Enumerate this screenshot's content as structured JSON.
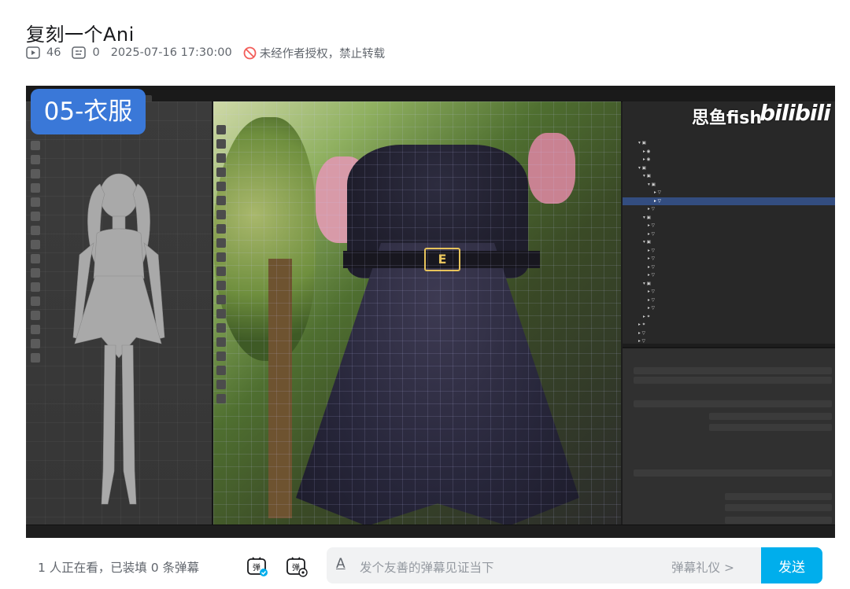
{
  "video": {
    "title": "复刻一个Ani",
    "play_count": "46",
    "danmaku_count": "0",
    "publish_time": "2025-07-16 17:30:00",
    "copyright_notice": "未经作者授权，禁止转载"
  },
  "player": {
    "episode_badge": "05-衣服",
    "watermark_name": "思鱼fish",
    "watermark_logo": "bilibili"
  },
  "danmaku": {
    "viewers_text": "1 人正在看，已装填 0 条弹幕",
    "input_placeholder": "发个友善的弹幕见证当下",
    "etiquette_link": "弹幕礼仪 >",
    "send_label": "发送"
  },
  "colors": {
    "accent": "#00aeec",
    "badge": "#3a78d8",
    "text_secondary": "#61666d"
  }
}
